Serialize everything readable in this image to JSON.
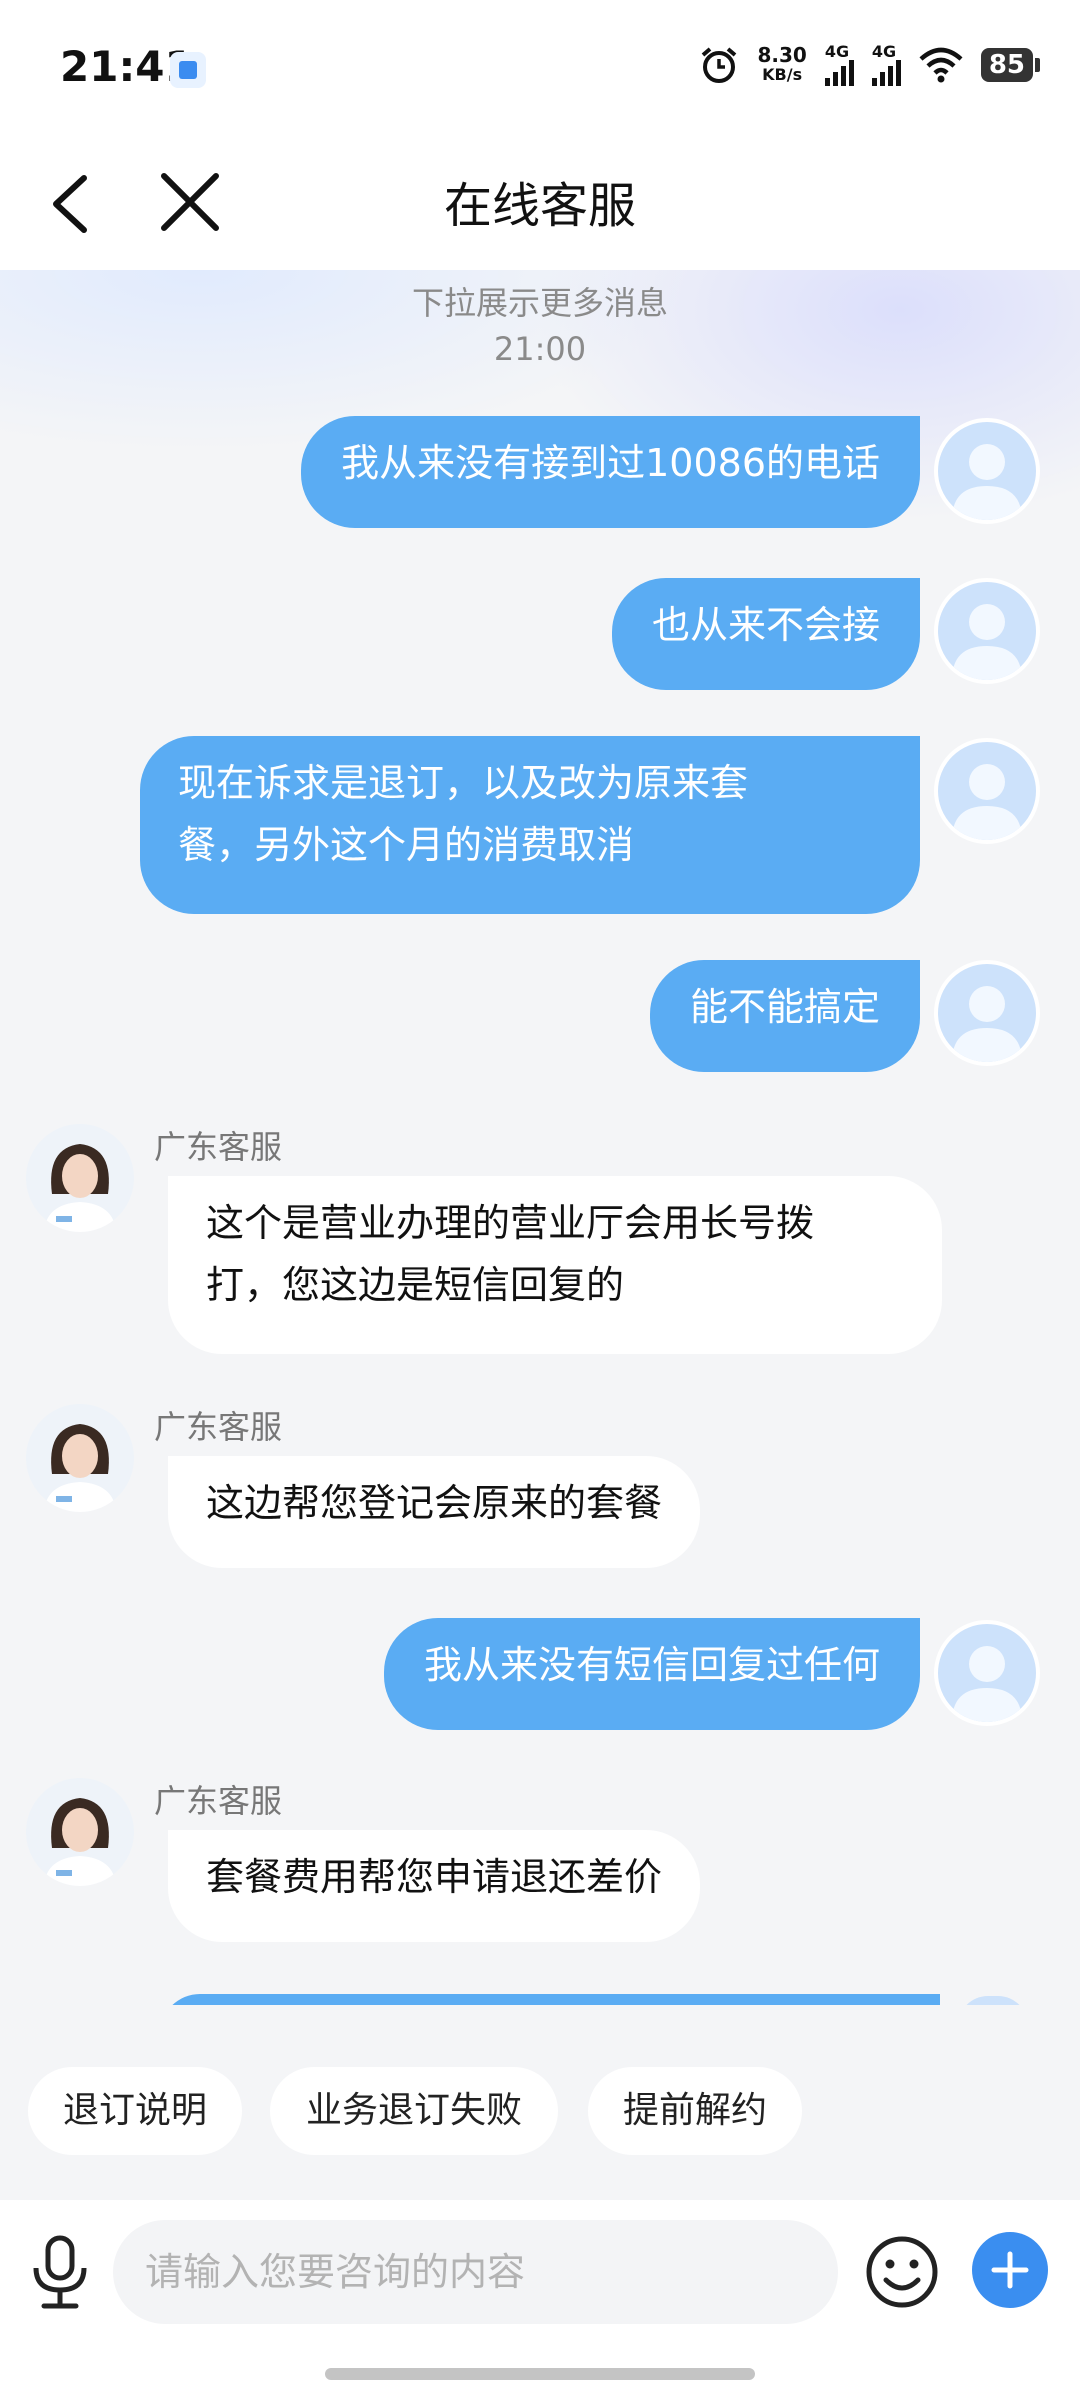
{
  "status": {
    "time": "21:41",
    "net_speed_value": "8.30",
    "net_speed_unit": "KB/s",
    "signal1": "4G",
    "signal2": "4G",
    "battery": "85",
    "icons": [
      "app-icon",
      "alarm-icon",
      "signal-icon",
      "signal-icon",
      "wifi-icon",
      "battery-icon"
    ]
  },
  "header": {
    "title": "在线客服",
    "back_icon": "chevron-left-icon",
    "close_icon": "close-icon"
  },
  "chat": {
    "pull_hint": "下拉展示更多消息",
    "timestamp": "21:00",
    "messages": [
      {
        "from": "user",
        "text": "我从来没有接到过10086的电话"
      },
      {
        "from": "user",
        "text": "也从来不会接"
      },
      {
        "from": "user",
        "line1": "现在诉求是退订，以及改为原来套",
        "line2": "餐，另外这个月的消费取消"
      },
      {
        "from": "user",
        "text": "能不能搞定"
      },
      {
        "from": "agent",
        "name": "广东客服",
        "line1": "这个是营业办理的营业厅会用长号拨",
        "line2": "打，您这边是短信回复的"
      },
      {
        "from": "agent",
        "name": "广东客服",
        "text": "这边帮您登记会原来的套餐"
      },
      {
        "from": "user",
        "text": "我从来没有短信回复过任何"
      },
      {
        "from": "agent",
        "name": "广东客服",
        "text": "套餐费用帮您申请退还差价"
      }
    ]
  },
  "quick_replies": [
    "退订说明",
    "业务退订失败",
    "提前解约"
  ],
  "input": {
    "placeholder": "请输入您要咨询的内容",
    "value": ""
  },
  "colors": {
    "user_bubble": "#5aacf3",
    "agent_bubble": "#ffffff",
    "accent": "#3a8ef0",
    "background": "#f4f5f7"
  }
}
